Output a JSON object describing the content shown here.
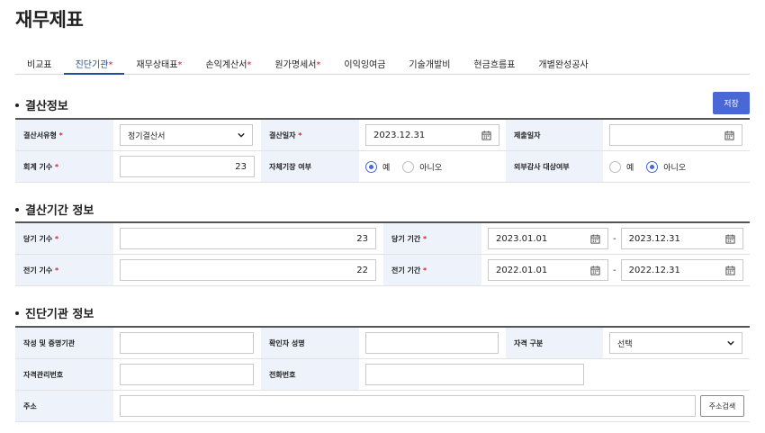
{
  "page": {
    "title": "재무제표"
  },
  "tabs": [
    {
      "label": "비교표",
      "required": ""
    },
    {
      "label": "진단기관",
      "required": "*"
    },
    {
      "label": "재무상태표",
      "required": "*"
    },
    {
      "label": "손익계산서",
      "required": "*"
    },
    {
      "label": "원가명세서",
      "required": "*"
    },
    {
      "label": "이익잉여금",
      "required": ""
    },
    {
      "label": "기술개발비",
      "required": ""
    },
    {
      "label": "현금흐름표",
      "required": ""
    },
    {
      "label": "개별완성공사",
      "required": ""
    }
  ],
  "active_tab": "진단기관",
  "req_mark": "*",
  "save_label": "저장",
  "settlement": {
    "title": "결산정보",
    "type_label": "결산서유형",
    "type_value": "정기결산서",
    "date_label": "결산일자",
    "date_value": "2023.12.31",
    "submit_label": "제출일자",
    "submit_value": "",
    "period_label": "회계 기수",
    "period_value": "23",
    "self_label": "자체기장 여부",
    "self_yes": "예",
    "self_no": "아니오",
    "self_selected": "yes",
    "audit_label": "외부감사 대상여부",
    "audit_yes": "예",
    "audit_no": "아니오",
    "audit_selected": "no"
  },
  "period": {
    "title": "결산기간 정보",
    "cur_term_label": "당기 기수",
    "cur_term_value": "23",
    "cur_range_label": "당기 기간",
    "cur_start": "2023.01.01",
    "cur_end": "2023.12.31",
    "prev_term_label": "전기 기수",
    "prev_term_value": "22",
    "prev_range_label": "전기 기간",
    "prev_start": "2022.01.01",
    "prev_end": "2022.12.31",
    "separator": "-"
  },
  "agency": {
    "title": "진단기관 정보",
    "writer_label": "작성 및 증명기관",
    "writer_value": "",
    "checker_label": "확인자 성명",
    "checker_value": "",
    "qual_label": "자격 구분",
    "qual_value": "선택",
    "qual_no_label": "자격관리번호",
    "qual_no_value": "",
    "phone_label": "전화번호",
    "phone_value": "",
    "address_label": "주소",
    "address_value": "",
    "address_button": "주소검색"
  },
  "colors": {
    "accent": "#4a67d6",
    "tab_active": "#1f4e9a",
    "required": "#d4232f",
    "label_bg": "#eef3fb"
  }
}
